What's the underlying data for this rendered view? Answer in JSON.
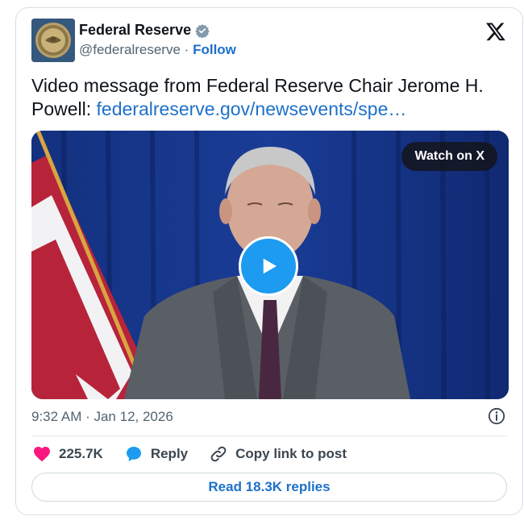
{
  "author": {
    "name": "Federal Reserve",
    "handle": "@federalreserve",
    "separator": "·",
    "follow_label": "Follow",
    "verified_icon": "verified-badge-icon"
  },
  "tweet": {
    "text": "Video message from Federal Reserve Chair Jerome H. Powell: ",
    "link_text": "federalreserve.gov/newsevents/spe…"
  },
  "media": {
    "watch_label": "Watch on X",
    "play_icon": "play-icon"
  },
  "timestamp": "9:32 AM · Jan 12, 2026",
  "actions": {
    "likes_count": "225.7K",
    "reply_label": "Reply",
    "copy_label": "Copy link to post"
  },
  "read_replies_label": "Read 18.3K replies",
  "colors": {
    "link": "#1d70c8",
    "heart": "#f91880",
    "reply_bubble": "#1d9bf0",
    "play": "#1d9bf0"
  }
}
